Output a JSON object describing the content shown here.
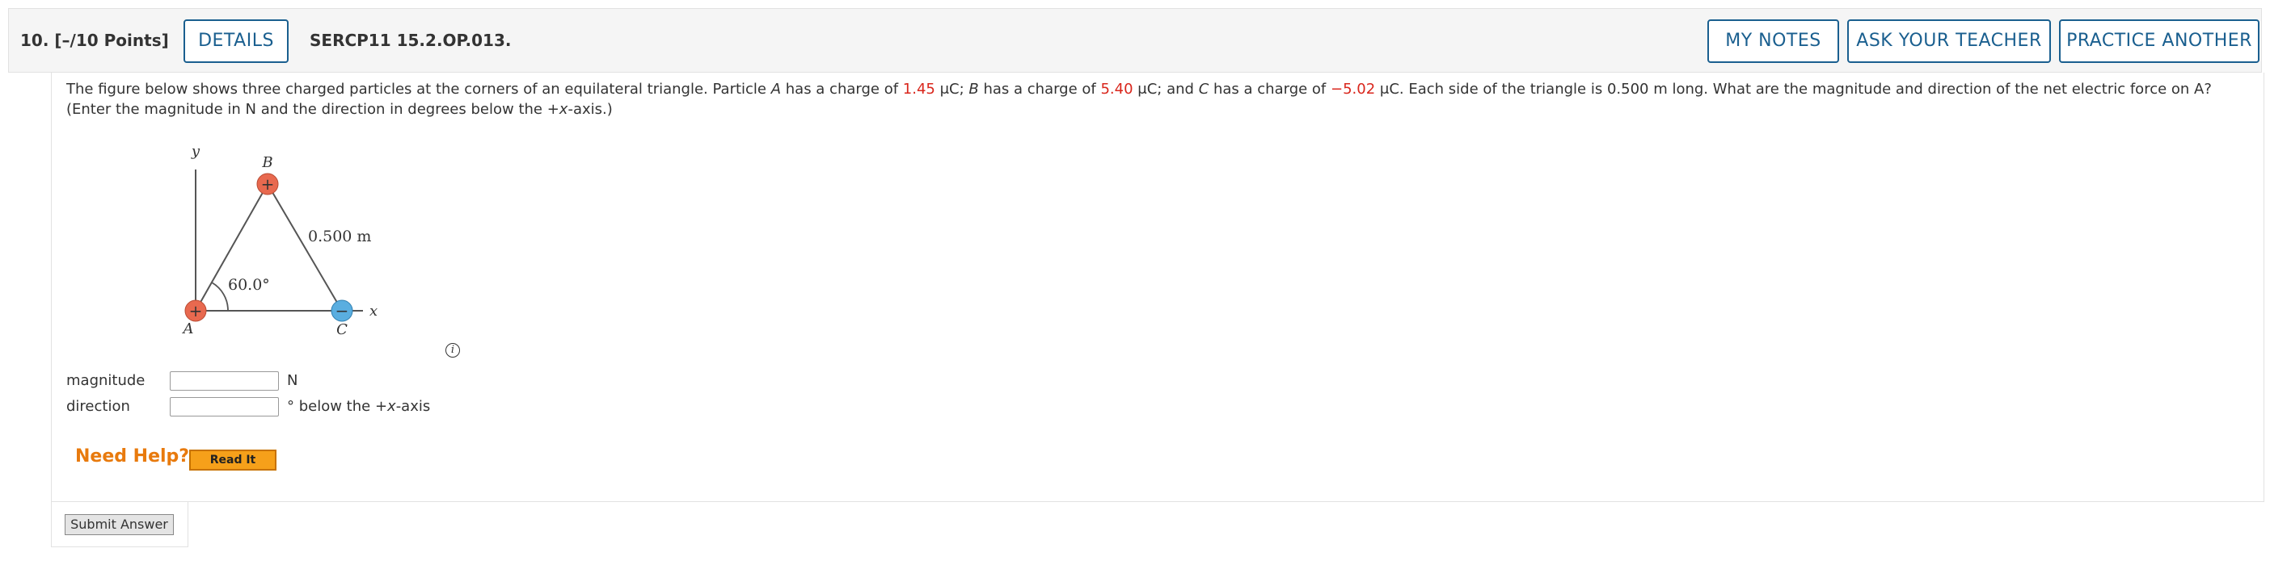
{
  "header": {
    "question_number": "10.",
    "points": "[–/10 Points]",
    "details_label": "DETAILS",
    "question_code": "SERCP11 15.2.OP.013.",
    "my_notes_label": "MY NOTES",
    "ask_teacher_label": "ASK YOUR TEACHER",
    "practice_label": "PRACTICE ANOTHER"
  },
  "question": {
    "intro": "The figure below shows three charged particles at the corners of an equilateral triangle. Particle ",
    "a_var": "A",
    "has_charge_of": " has a charge of ",
    "charge_a": "1.45",
    "unit_sep_b": " μC; ",
    "b_var": "B",
    "charge_b": "5.40",
    "unit_sep_c": " μC; and ",
    "c_var": "C",
    "charge_c": "−5.02",
    "rest": " μC. Each side of the triangle is 0.500 m long. What are the magnitude and direction of the net electric force on A? (Enter the magnitude in N and the direction in degrees below the +",
    "x_var": "x",
    "end": "-axis.)"
  },
  "figure": {
    "y_axis_label": "y",
    "x_axis_label": "x",
    "label_a": "A",
    "label_b": "B",
    "label_c": "C",
    "side_label": "0.500 m",
    "angle_label": "60.0°",
    "plus_sign": "+",
    "minus_sign": "−",
    "positive_color": "#e8694f",
    "negative_color": "#5aaee0"
  },
  "info_icon": "i",
  "answers": {
    "magnitude_label": "magnitude",
    "magnitude_value": "",
    "magnitude_unit": "N",
    "direction_label": "direction",
    "direction_value": "",
    "direction_unit_pre": "° below the +",
    "direction_unit_var": "x",
    "direction_unit_post": "-axis"
  },
  "help": {
    "need_help_label": "Need Help?",
    "read_it_label": "Read It"
  },
  "submit_label": "Submit Answer"
}
